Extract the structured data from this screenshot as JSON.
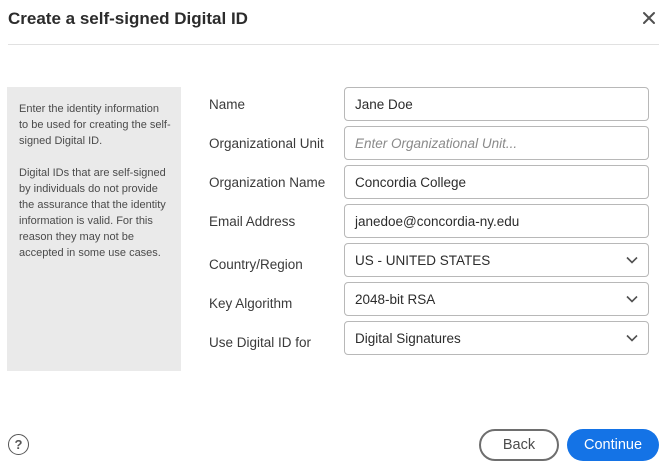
{
  "dialog": {
    "title": "Create a self-signed Digital ID"
  },
  "info": {
    "paragraph1": "Enter the identity information to be used for creating the self-signed Digital ID.",
    "paragraph2": "Digital IDs that are self-signed by individuals do not provide the assurance that the identity information is valid. For this reason they may not be accepted in some use cases."
  },
  "form": {
    "name": {
      "label": "Name",
      "value": "Jane Doe"
    },
    "org_unit": {
      "label": "Organizational Unit",
      "placeholder": "Enter Organizational Unit..."
    },
    "org_name": {
      "label": "Organization Name",
      "value": "Concordia College"
    },
    "email": {
      "label": "Email Address",
      "value": "janedoe@concordia-ny.edu"
    },
    "country": {
      "label": "Country/Region",
      "value": "US - UNITED STATES"
    },
    "key_algorithm": {
      "label": "Key Algorithm",
      "value": "2048-bit RSA"
    },
    "use_for": {
      "label": "Use Digital ID for",
      "value": "Digital Signatures"
    }
  },
  "footer": {
    "help_symbol": "?",
    "back_label": "Back",
    "continue_label": "Continue"
  },
  "icons": {
    "close": "close-icon",
    "help": "help-icon",
    "dropdown": "chevron-down-icon"
  },
  "colors": {
    "primary": "#1473e6",
    "panel_bg": "#eaeaea"
  }
}
